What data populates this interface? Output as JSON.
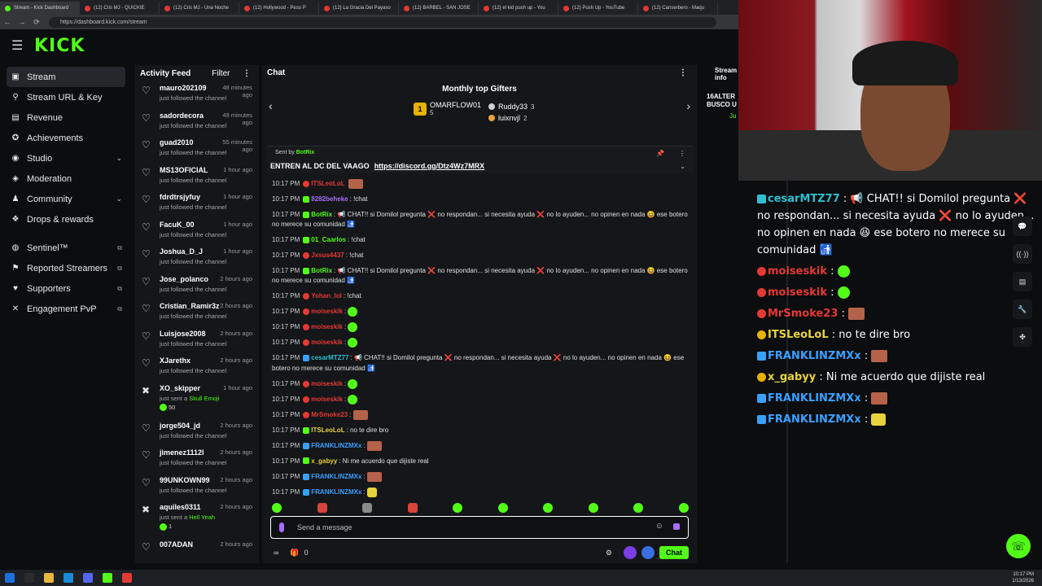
{
  "browser": {
    "tabs": [
      {
        "label": "Stream - Kick Dashboard",
        "active": true
      },
      {
        "label": "(12) Cris MJ - QUICKIE"
      },
      {
        "label": "(12) Cris MJ - Una Noche"
      },
      {
        "label": "(12) Hollywood - Peso P"
      },
      {
        "label": "(12) La Gracia Del Payaso"
      },
      {
        "label": "(12) BARBEL - SAN JOSE"
      },
      {
        "label": "(12) el kid push up - You"
      },
      {
        "label": "(12) Push Up - YouTube"
      },
      {
        "label": "(12) Canserbero - Maqu"
      }
    ],
    "url": "https://dashboard.kick.com/stream"
  },
  "brand": {
    "logo": "KICK",
    "accent": "#53fc18"
  },
  "sidebar": {
    "items": [
      {
        "label": "Stream",
        "icon": "stream-icon",
        "active": true
      },
      {
        "label": "Stream URL & Key",
        "icon": "link-icon"
      },
      {
        "label": "Revenue",
        "icon": "revenue-icon"
      },
      {
        "label": "Achievements",
        "icon": "trophy-icon"
      },
      {
        "label": "Studio",
        "icon": "studio-icon",
        "chevron": true
      },
      {
        "label": "Moderation",
        "icon": "shield-icon"
      },
      {
        "label": "Community",
        "icon": "community-icon",
        "chevron": true
      },
      {
        "label": "Drops & rewards",
        "icon": "gift-icon"
      }
    ],
    "external": [
      {
        "label": "Sentinel™",
        "icon": "sentinel-icon"
      },
      {
        "label": "Reported Streamers",
        "icon": "report-icon"
      },
      {
        "label": "Supporters",
        "icon": "supporters-icon"
      },
      {
        "label": "Engagement PvP",
        "icon": "pvp-icon"
      }
    ]
  },
  "activity": {
    "title": "Activity Feed",
    "filter": "Filter",
    "items": [
      {
        "name": "mauro202109",
        "time": "48 minutes ago",
        "desc": "just followed the channel"
      },
      {
        "name": "sadordecora",
        "time": "49 minutes ago",
        "desc": "just followed the channel"
      },
      {
        "name": "guad2010",
        "time": "55 minutes ago",
        "desc": "just followed the channel"
      },
      {
        "name": "MS13OFICIAL",
        "time": "1 hour ago",
        "desc": "just followed the channel"
      },
      {
        "name": "fdrdtrsjyfuy",
        "time": "1 hour ago",
        "desc": "just followed the channel"
      },
      {
        "name": "FacuK_00",
        "time": "1 hour ago",
        "desc": "just followed the channel"
      },
      {
        "name": "Joshua_D_J",
        "time": "1 hour ago",
        "desc": "just followed the channel"
      },
      {
        "name": "Jose_polanco",
        "time": "2 hours ago",
        "desc": "just followed the channel"
      },
      {
        "name": "Cristian_Ramir3z",
        "time": "2 hours ago",
        "desc": "just followed the channel"
      },
      {
        "name": "Luisjose2008",
        "time": "2 hours ago",
        "desc": "just followed the channel"
      },
      {
        "name": "XJarethx",
        "time": "2 hours ago",
        "desc": "just followed the channel"
      },
      {
        "name": "XO_skipper",
        "time": "1 hour ago",
        "desc": "just sent a",
        "highlight": "Skull Emoji",
        "extra": "50",
        "kind": "gift"
      },
      {
        "name": "jorge504_jd",
        "time": "2 hours ago",
        "desc": "just followed the channel"
      },
      {
        "name": "jimenez1112l",
        "time": "2 hours ago",
        "desc": "just followed the channel"
      },
      {
        "name": "99UNKOWN99",
        "time": "2 hours ago",
        "desc": "just followed the channel"
      },
      {
        "name": "aquiles0311",
        "time": "2 hours ago",
        "desc": "just sent a",
        "highlight": "Hell Yeah",
        "extra": "1",
        "kind": "gift"
      },
      {
        "name": "007ADAN",
        "time": "2 hours ago",
        "desc": ""
      }
    ]
  },
  "chat": {
    "title": "Chat",
    "gifters_title": "Monthly top Gifters",
    "top_gifter": {
      "name": "OMARFLOW01",
      "count": "5",
      "rank": "1"
    },
    "gifters": [
      {
        "name": "Ruddy33",
        "count": "3"
      },
      {
        "name": "luixnvjl",
        "count": "2"
      }
    ],
    "pinned": {
      "sent_by_label": "Sent by",
      "sender": "BotRix",
      "message": "ENTREN AL DC DEL VAAGO",
      "link": "https://discord.gg/Dtz4Wz7MRX"
    },
    "messages": [
      {
        "time": "10:17 PM",
        "user": "ITSLeoLoL",
        "color": "#e53935",
        "text": "",
        "emote": "r"
      },
      {
        "time": "10:17 PM",
        "user": "8282beheke",
        "color": "#a86cf7",
        "text": ": !chat"
      },
      {
        "time": "10:17 PM",
        "user": "BotRix",
        "color": "#53fc18",
        "text": ": 📢 CHAT!! si Domilol pregunta ❌ no respondan... si necesita ayuda ❌ no lo ayuden... no opinen en nada 😆 ese botero no merece su comunidad 🚮"
      },
      {
        "time": "10:17 PM",
        "user": "01_Caarlos",
        "color": "#53fc18",
        "text": ": !chat"
      },
      {
        "time": "10:17 PM",
        "user": "Jxsus4437",
        "color": "#e53935",
        "text": ": !chat"
      },
      {
        "time": "10:17 PM",
        "user": "BotRix",
        "color": "#53fc18",
        "text": ": 📢 CHAT!! si Domilol pregunta ❌ no respondan... si necesita ayuda ❌ no lo ayuden... no opinen en nada 😆 ese botero no merece su comunidad 🚮"
      },
      {
        "time": "10:17 PM",
        "user": "Yohan_lol",
        "color": "#e53935",
        "text": ": !chat"
      },
      {
        "time": "10:17 PM",
        "user": "moiseskik",
        "color": "#e53935",
        "text": ":",
        "emote": "g"
      },
      {
        "time": "10:17 PM",
        "user": "moiseskik",
        "color": "#e53935",
        "text": ":",
        "emote": "g"
      },
      {
        "time": "10:17 PM",
        "user": "moiseskik",
        "color": "#e53935",
        "text": ":",
        "emote": "g"
      },
      {
        "time": "10:17 PM",
        "user": "cesarMTZ77",
        "color": "#2fbfd0",
        "text": ": 📢 CHAT!! si Domilol pregunta ❌ no respondan... si necesita ayuda ❌ no lo ayuden... no opinen en nada 😆 ese botero no merece su comunidad 🚮"
      },
      {
        "time": "10:17 PM",
        "user": "moiseskik",
        "color": "#e53935",
        "text": ":",
        "emote": "g"
      },
      {
        "time": "10:17 PM",
        "user": "moiseskik",
        "color": "#e53935",
        "text": ":",
        "emote": "g"
      },
      {
        "time": "10:17 PM",
        "user": "MrSmoke23",
        "color": "#e53935",
        "text": ":",
        "emote": "r"
      },
      {
        "time": "10:17 PM",
        "user": "ITSLeoLoL",
        "color": "#e8d33c",
        "text": ": no te dire bro"
      },
      {
        "time": "10:17 PM",
        "user": "FRANKLINZMXx",
        "color": "#3aa0ff",
        "text": ":",
        "emote": "r"
      },
      {
        "time": "10:17 PM",
        "user": "x_gabyy",
        "color": "#e8d33c",
        "text": ": Ni me acuerdo que dijiste real"
      },
      {
        "time": "10:17 PM",
        "user": "FRANKLINZMXx",
        "color": "#3aa0ff",
        "text": ":",
        "emote": "r"
      },
      {
        "time": "10:17 PM",
        "user": "FRANKLINZMXx",
        "color": "#3aa0ff",
        "text": ":",
        "emote": "y"
      }
    ],
    "input_placeholder": "Send a message",
    "footer_count": "0",
    "chat_button": "Chat"
  },
  "stream_info": {
    "title": "Stream info",
    "text": "16ALTER BUSCO U",
    "extra": "Ju"
  },
  "overlay": {
    "messages": [
      {
        "user": "cesarMTZ77",
        "color": "#2fbfd0",
        "text": ": 📢 CHAT!! si Domilol pregunta ❌ no respondan... si necesita ayuda ❌ no lo ayuden... no opinen en nada 😆 ese botero no merece su comunidad 🚮"
      },
      {
        "user": "moiseskik",
        "color": "#e53935",
        "text": ":",
        "emote": "g"
      },
      {
        "user": "moiseskik",
        "color": "#e53935",
        "text": ":",
        "emote": "g"
      },
      {
        "user": "MrSmoke23",
        "color": "#e53935",
        "text": ":",
        "emote": "r"
      },
      {
        "user": "ITSLeoLoL",
        "color": "#e8d33c",
        "text": ": no te dire bro"
      },
      {
        "user": "FRANKLINZMXx",
        "color": "#3aa0ff",
        "text": ":",
        "emote": "r"
      },
      {
        "user": "x_gabyy",
        "color": "#e8d33c",
        "text": ": Ni me acuerdo que dijiste real"
      },
      {
        "user": "FRANKLINZMXx",
        "color": "#3aa0ff",
        "text": ":",
        "emote": "r"
      },
      {
        "user": "FRANKLINZMXx",
        "color": "#3aa0ff",
        "text": ":",
        "emote": "y"
      }
    ]
  },
  "taskbar": {
    "time": "10:17 PM",
    "date": "1/13/2026"
  }
}
